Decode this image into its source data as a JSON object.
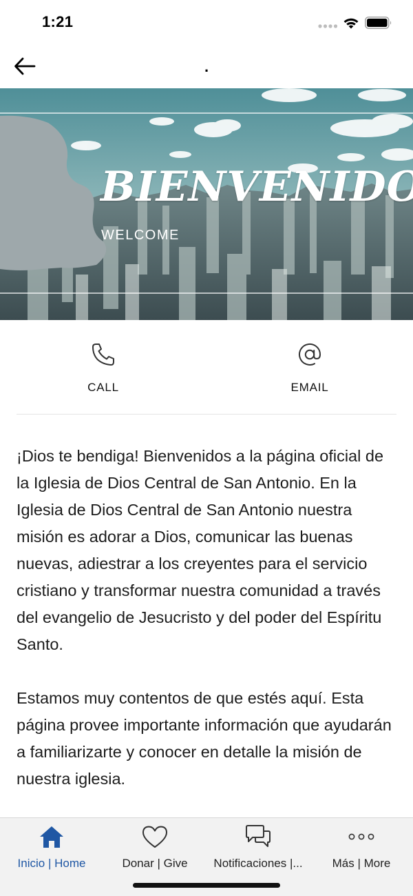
{
  "status_bar": {
    "time": "1:21",
    "icons": [
      "signal-dots-icon",
      "wifi-icon",
      "battery-icon"
    ]
  },
  "nav": {
    "title": ".",
    "back_icon": "arrow-left-icon"
  },
  "hero": {
    "title": "BIENVENIDO",
    "subtitle": "WELCOME",
    "image": "city-skyline-photo"
  },
  "actions": [
    {
      "label": "CALL",
      "icon": "phone-icon"
    },
    {
      "label": "EMAIL",
      "icon": "at-sign-icon"
    }
  ],
  "content": {
    "paragraphs": [
      "¡Dios te bendiga! Bienvenidos a la página oficial de la Iglesia de Dios Central de San Antonio. En la Iglesia de Dios Central de San Antonio nuestra misión es adorar a Dios, comunicar las buenas nuevas, adiestrar a los creyentes para el servicio cristiano y transformar nuestra comunidad a través del evangelio de Jesucristo y del poder del Espíritu Santo.",
      "Estamos muy contentos de que estés aquí. Esta página provee importante información que ayudarán a familiarizarte y conocer en detalle la misión de nuestra iglesia."
    ]
  },
  "tab_bar": {
    "tabs": [
      {
        "label": "Inicio | Home",
        "icon": "home-icon",
        "active": true
      },
      {
        "label": "Donar | Give",
        "icon": "heart-icon",
        "active": false
      },
      {
        "label": "Notificaciones |...",
        "icon": "chat-bubbles-icon",
        "active": false
      },
      {
        "label": "Más | More",
        "icon": "more-dots-icon",
        "active": false
      }
    ]
  },
  "colors": {
    "accent": "#1f57a4",
    "tab_bar_bg": "#f2f2f2",
    "text": "#1c1c1c"
  }
}
